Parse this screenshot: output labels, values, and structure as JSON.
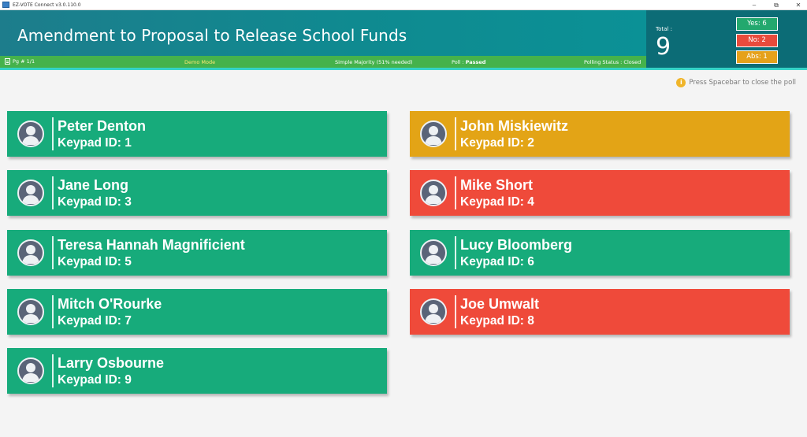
{
  "window": {
    "title": "EZ-VOTE Connect v3.0.110.0"
  },
  "header": {
    "title": "Amendment to Proposal to Release School Funds"
  },
  "status": {
    "page": "Pg # 1/1",
    "mode": "Demo Mode",
    "majority": "Simple Majority (51% needed)",
    "poll_label": "Poll : ",
    "poll_value": "Passed",
    "polling_status": "Polling Status : Closed"
  },
  "totals": {
    "label": "Total :",
    "value": "9",
    "yes": "Yes: 6",
    "no": "No: 2",
    "abs": "Abs: 1"
  },
  "hint": "Press Spacebar to close the poll",
  "colors": {
    "yes": "#17ab7b",
    "no": "#ef4a3a",
    "abs": "#e3a416",
    "header": "#0f8a90",
    "statusbar": "#45b24b"
  },
  "voters": [
    {
      "name": "Peter Denton",
      "keypad": "Keypad ID: 1",
      "vote": "yes"
    },
    {
      "name": "John Miskiewitz",
      "keypad": "Keypad ID: 2",
      "vote": "abs"
    },
    {
      "name": "Jane Long",
      "keypad": "Keypad ID: 3",
      "vote": "yes"
    },
    {
      "name": "Mike Short",
      "keypad": "Keypad ID: 4",
      "vote": "no"
    },
    {
      "name": "Teresa Hannah Magnificient",
      "keypad": "Keypad ID: 5",
      "vote": "yes"
    },
    {
      "name": "Lucy Bloomberg",
      "keypad": "Keypad ID: 6",
      "vote": "yes"
    },
    {
      "name": "Mitch O'Rourke",
      "keypad": "Keypad ID: 7",
      "vote": "yes"
    },
    {
      "name": "Joe Umwalt",
      "keypad": "Keypad ID: 8",
      "vote": "no"
    },
    {
      "name": "Larry Osbourne",
      "keypad": "Keypad ID: 9",
      "vote": "yes"
    }
  ]
}
